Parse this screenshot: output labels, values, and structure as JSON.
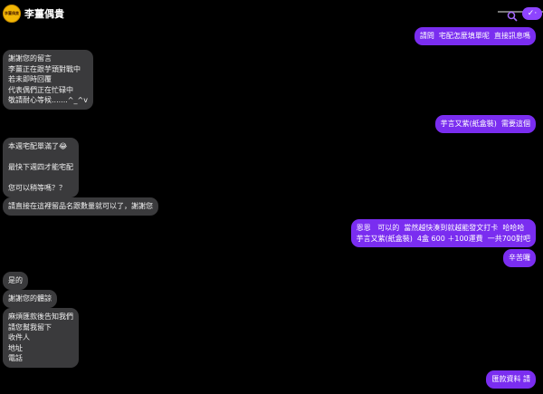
{
  "header": {
    "title": "李薑偶貴",
    "avatar_text": "李薑偶貴",
    "search_icon": "search-icon",
    "check_icon": "check-icon",
    "check_label": "✓·"
  },
  "messages": [
    {
      "dir": "out",
      "text": "請問  宅配怎麼填單呢  直接訊息嗎"
    },
    {
      "dir": "in",
      "text": "謝謝您的留言\n李薑正在跟芋頭對戰中\n若未即時回覆\n代表偶們正在忙碌中\n敬請耐心等候.......^_^v"
    },
    {
      "dir": "out",
      "text": "芋言又紫(紙盒裝)  需要這個"
    },
    {
      "dir": "in",
      "text": "本週宅配單滿了😂\n\n最快下週四才能宅配\n\n您可以稍等嗎？？"
    },
    {
      "dir": "in",
      "text": "請直接在這裡留品名跟數量就可以了，謝謝您"
    },
    {
      "dir": "out",
      "text": "恩恩   可以的  當然越快湊到就越能發文打卡  哈哈哈\n芋言又紫(紙盒裝)  4盒 600 ＋100運費  一共700對吧"
    },
    {
      "dir": "out",
      "text": "辛苦囉"
    },
    {
      "dir": "in",
      "text": "是的"
    },
    {
      "dir": "in",
      "text": "謝謝您的體諒"
    },
    {
      "dir": "in",
      "text": "麻煩匯款後告知我們\n請您幫我留下\n收件人\n地址\n電話"
    },
    {
      "dir": "out",
      "text": "匯款資料 請"
    }
  ]
}
